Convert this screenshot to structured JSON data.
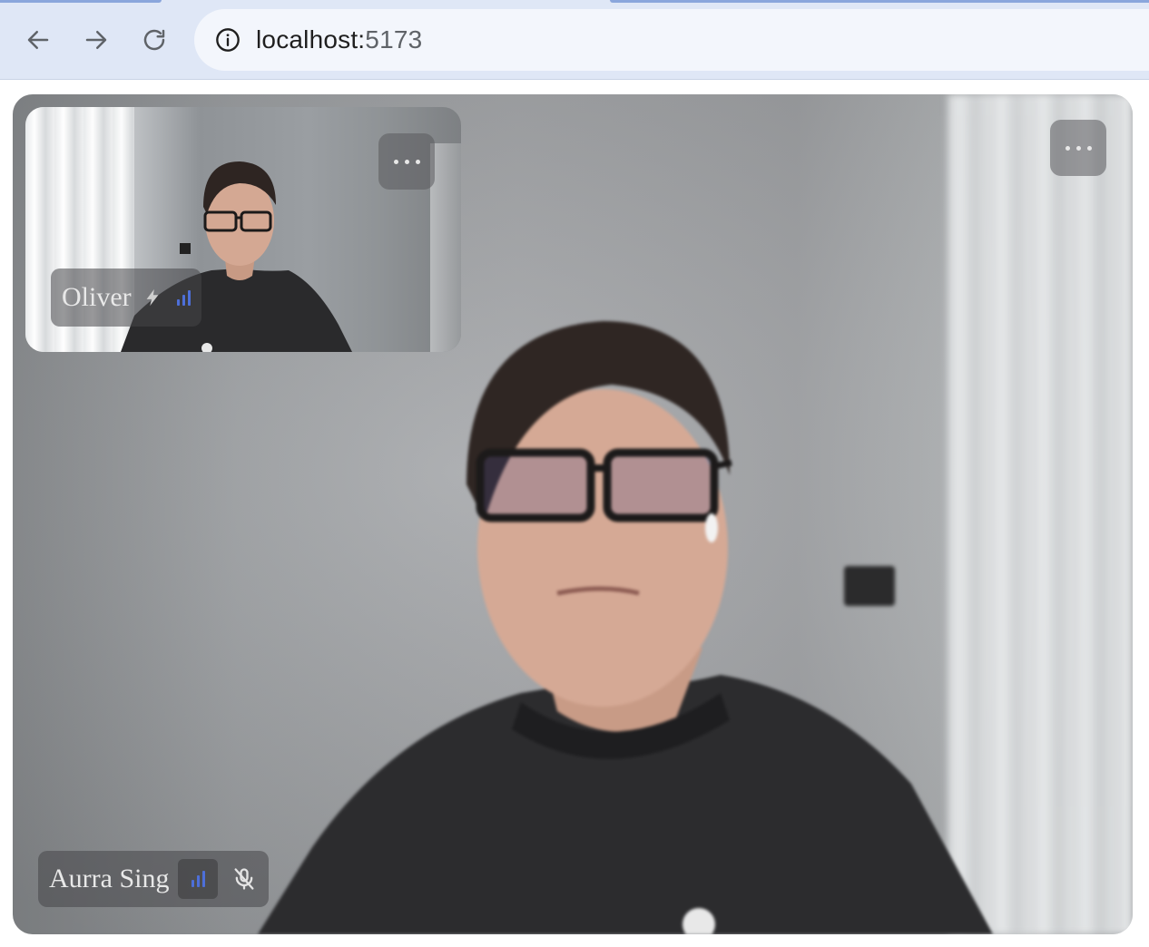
{
  "browser": {
    "url_host": "localhost:",
    "url_port": "5173"
  },
  "main_participant": {
    "name": "Aurra Sing",
    "muted": true,
    "connection_quality_icon": "signal-bars-icon"
  },
  "pip_participant": {
    "name": "Oliver",
    "connection_quality_icon": "signal-bars-icon",
    "status_icon": "lightning-icon"
  },
  "icons": {
    "more": "more-horizontal-icon",
    "mic": "mic-off-icon"
  },
  "colors": {
    "signal_bars": "#4d6fd9",
    "chrome_background": "#dfe7f6"
  }
}
